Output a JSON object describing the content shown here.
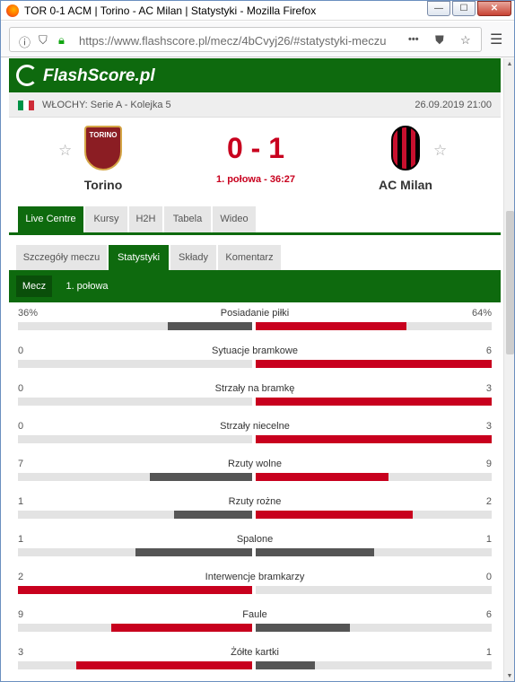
{
  "window": {
    "title": "TOR 0-1 ACM | Torino - AC Milan | Statystyki - Mozilla Firefox",
    "min_label": "—",
    "max_label": "☐",
    "close_label": "✕"
  },
  "browser": {
    "url": "https://www.flashscore.pl/mecz/4bCvyj26/#statystyki-meczu",
    "more_label": "•••"
  },
  "site": {
    "logo": "FlashScore.pl"
  },
  "match": {
    "league": "WŁOCHY: Serie A - Kolejka 5",
    "datetime": "26.09.2019 21:00",
    "home_team": "Torino",
    "home_logo_text": "TORINO",
    "away_team": "AC Milan",
    "score": "0 - 1",
    "status": "1. połowa - 36:27"
  },
  "tabs_main": [
    {
      "label": "Live Centre",
      "active": true
    },
    {
      "label": "Kursy",
      "active": false
    },
    {
      "label": "H2H",
      "active": false
    },
    {
      "label": "Tabela",
      "active": false
    },
    {
      "label": "Wideo",
      "active": false
    }
  ],
  "tabs_sub": [
    {
      "label": "Szczegóły meczu",
      "active": false
    },
    {
      "label": "Statystyki",
      "active": true
    },
    {
      "label": "Składy",
      "active": false
    },
    {
      "label": "Komentarz",
      "active": false
    }
  ],
  "periods": [
    {
      "label": "Mecz",
      "active": true
    },
    {
      "label": "1. połowa",
      "active": false
    }
  ],
  "colors": {
    "green": "#0e6a0e",
    "leader": "#c8001e",
    "trailer": "#555555"
  },
  "stats": [
    {
      "name": "Posiadanie piłki",
      "home": "36%",
      "away": "64%",
      "home_share": 0.36,
      "away_share": 0.64
    },
    {
      "name": "Sytuacje bramkowe",
      "home": "0",
      "away": "6",
      "home_share": 0,
      "away_share": 1
    },
    {
      "name": "Strzały na bramkę",
      "home": "0",
      "away": "3",
      "home_share": 0,
      "away_share": 1
    },
    {
      "name": "Strzały niecelne",
      "home": "0",
      "away": "3",
      "home_share": 0,
      "away_share": 1
    },
    {
      "name": "Rzuty wolne",
      "home": "7",
      "away": "9",
      "home_share": 0.4375,
      "away_share": 0.5625
    },
    {
      "name": "Rzuty rożne",
      "home": "1",
      "away": "2",
      "home_share": 0.333,
      "away_share": 0.667
    },
    {
      "name": "Spalone",
      "home": "1",
      "away": "1",
      "home_share": 0.5,
      "away_share": 0.5
    },
    {
      "name": "Interwencje bramkarzy",
      "home": "2",
      "away": "0",
      "home_share": 1,
      "away_share": 0
    },
    {
      "name": "Faule",
      "home": "9",
      "away": "6",
      "home_share": 0.6,
      "away_share": 0.4
    },
    {
      "name": "Żółte kartki",
      "home": "3",
      "away": "1",
      "home_share": 0.75,
      "away_share": 0.25
    }
  ]
}
